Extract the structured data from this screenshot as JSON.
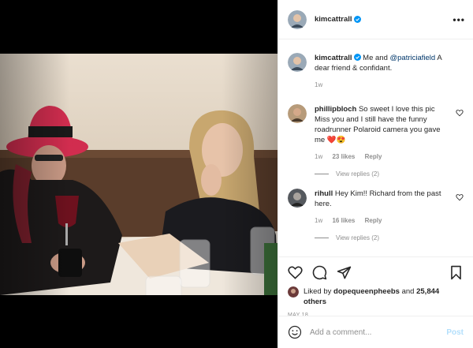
{
  "colors": {
    "link": "#00376b",
    "verified": "#0095f6",
    "muted": "#8e8e8e",
    "post_disabled": "#b2dffc"
  },
  "header": {
    "username": "kimcattrall",
    "more_icon": "more-horizontal-icon",
    "more_label": "•••"
  },
  "caption": {
    "username": "kimcattrall",
    "text_before": "Me and ",
    "mention": "@patriciafield",
    "text_after": " A dear friend & confidant.",
    "age": "1w"
  },
  "comments": [
    {
      "username": "phillipbloch",
      "text": "So sweet I love this pic Miss you and I still have the funny roadrunner Polaroid camera you gave me ❤️😍",
      "age": "1w",
      "likes": "23 likes",
      "reply_label": "Reply",
      "view_replies": "View replies (2)"
    },
    {
      "username": "rihull",
      "text": "Hey Kim!! Richard from the past here.",
      "age": "1w",
      "likes": "16 likes",
      "reply_label": "Reply",
      "view_replies": "View replies (2)"
    }
  ],
  "likes": {
    "prefix": "Liked by ",
    "user": "dopequeenpheebs",
    "middle": " and ",
    "count": "25,844 others"
  },
  "date": "MAY 18",
  "add_comment": {
    "placeholder": "Add a comment...",
    "post_label": "Post"
  }
}
